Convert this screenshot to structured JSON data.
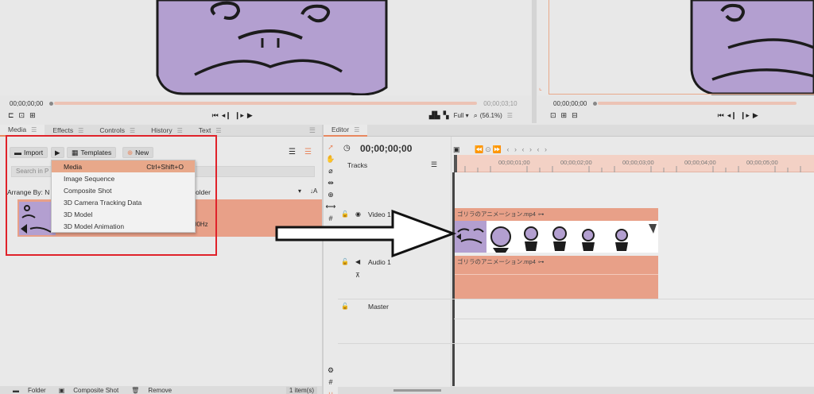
{
  "viewer_left": {
    "timecode_start": "00;00;00;00",
    "timecode_end": "00;00;03;10",
    "zoom_select": "Full",
    "zoom_pct": "(56.1%)"
  },
  "viewer_right": {
    "timecode_start": "00;00;00;00"
  },
  "media_panel": {
    "tabs": [
      "Media",
      "Effects",
      "Controls",
      "History",
      "Text"
    ],
    "import_label": "Import",
    "templates_label": "Templates",
    "new_label": "New",
    "search_placeholder": "Search in P",
    "arrange_label": "Arrange By: N",
    "arrange_value": "older",
    "media_item_meta": "00Hz"
  },
  "dropdown": {
    "items": [
      {
        "label": "Media",
        "shortcut": "Ctrl+Shift+O"
      },
      {
        "label": "Image Sequence",
        "shortcut": ""
      },
      {
        "label": "Composite Shot",
        "shortcut": ""
      },
      {
        "label": "3D Camera Tracking Data",
        "shortcut": ""
      },
      {
        "label": "3D Model",
        "shortcut": ""
      },
      {
        "label": "3D Model Animation",
        "shortcut": ""
      }
    ]
  },
  "bottom_bar": {
    "folder": "Folder",
    "composite": "Composite Shot",
    "remove": "Remove",
    "count": "1 item(s)"
  },
  "editor": {
    "tab": "Editor",
    "timecode": "00;00;00;00",
    "tracks_label": "Tracks",
    "ruler_ticks": [
      "00;00;01;00",
      "00;00;02;00",
      "00;00;03;00",
      "00;00;04;00",
      "00;00;05;00"
    ],
    "video_track": "Video 1",
    "audio_track": "Audio 1",
    "master_track": "Master",
    "video_clip_name": "ゴリラのアニメーション.mp4",
    "audio_clip_name": "ゴリラのアニメーション.mp4"
  },
  "colors": {
    "accent": "#e8875f",
    "clip": "#e8a088",
    "highlight": "#e0222a",
    "purple": "#b39fd0"
  }
}
